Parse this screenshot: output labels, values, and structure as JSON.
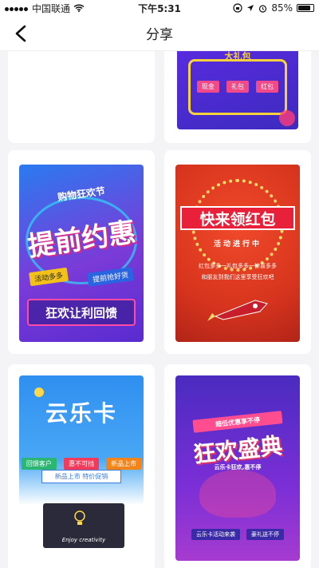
{
  "status_bar": {
    "carrier": "中国联通",
    "time": "下午5:31",
    "battery": "85%",
    "battery_level": 0.85,
    "icons": [
      "signal-dots-icon",
      "wifi-icon",
      "lock-rotation-icon",
      "location-icon",
      "alarm-icon",
      "battery-icon"
    ]
  },
  "nav": {
    "title": "分享",
    "back_icon": "chevron-left-icon"
  },
  "posters": [
    {
      "id": "poster-1",
      "buttons": [
        "现金",
        "礼包",
        "红包"
      ],
      "headline": "大礼包"
    },
    {
      "id": "poster-2",
      "tag": "购物狂欢节",
      "headline": "提前约惠",
      "sub_left": "活动多多",
      "sub_right": "提前抢好货",
      "footer": "狂欢让利回馈"
    },
    {
      "id": "poster-3",
      "headline": "快来领红包",
      "ribbon": "活动进行中",
      "body_line1": "红包多多一礼包多多一惊喜多多",
      "body_line2": "和朋友到我们这里享受狂欢吧"
    },
    {
      "id": "poster-4",
      "headline": "云乐卡",
      "chips": [
        "回馈客户",
        "惠不可挡",
        "新品上市"
      ],
      "tagline": "新品上市 特价促销",
      "screen_text": "Enjoy creativity"
    },
    {
      "id": "poster-5",
      "top_banner": "超低优惠享不停",
      "headline": "狂欢盛典",
      "sub": "云乐卡狂欢,惠不停",
      "bottom_left": "云乐卡活动来袭",
      "bottom_right": "豪礼送不停"
    }
  ]
}
